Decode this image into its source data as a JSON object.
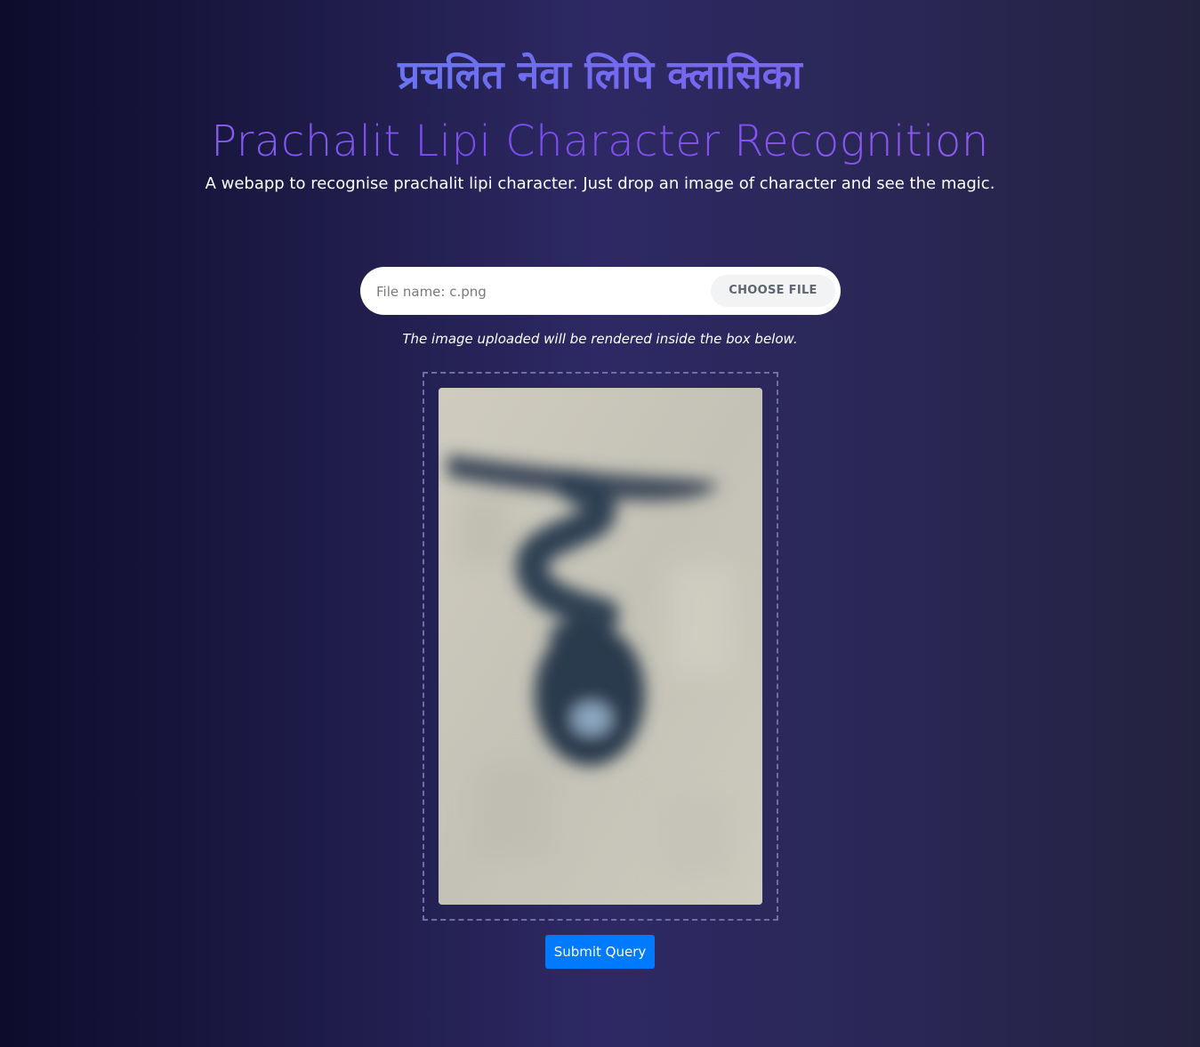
{
  "header": {
    "script_title": "प्रचलित नेवा लिपि क्लासिका",
    "title": "Prachalit Lipi Character Recognition",
    "subtitle": "A webapp to recognise prachalit lipi character. Just drop an image of character and see the magic."
  },
  "upload": {
    "file_name_value": "File name: c.png",
    "choose_file_label": "CHOOSE FILE"
  },
  "hint": "The image uploaded will be rendered inside the box below.",
  "submit_label": "Submit Query",
  "colors": {
    "submit_button": "#007bff",
    "title_gradient_start": "#8e6af3",
    "title_gradient_end": "#9a5ef4"
  }
}
